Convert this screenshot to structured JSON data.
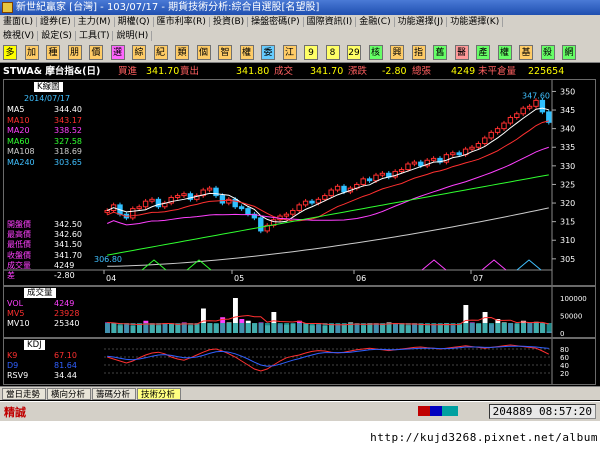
{
  "window": {
    "title": "新世紀贏家 [台灣] - 103/07/17 - 期貨技術分析:綜合自選股[名望股]"
  },
  "menu_row1": [
    "畫面(L)",
    "證券(E)",
    "主力(M)",
    "期權(Q)",
    "匯市利率(R)",
    "投資(B)",
    "操盤密碼(P)",
    "國際資訊(I)",
    "金融(C)",
    "功能選擇(J)",
    "功能選擇(K)"
  ],
  "menu_row2": [
    "檢視(V)",
    "設定(S)",
    "工具(T)",
    "說明(H)"
  ],
  "toolbar": {
    "buttons": [
      "多",
      "加",
      "種",
      "朋",
      "價",
      "選",
      "綜",
      "紀",
      "類",
      "個",
      "智",
      "權",
      "委",
      "江",
      "9",
      "8",
      "29",
      "核",
      "興",
      "指",
      "舊",
      "醫",
      "產",
      "權",
      "基",
      "殺",
      "網"
    ],
    "colors": [
      "#ffff00",
      "#ffcc66",
      "#ffcc66",
      "#ffcc66",
      "#ffcc66",
      "#ff66ff",
      "#ffcc66",
      "#ffcc66",
      "#ffcc66",
      "#ffcc66",
      "#ffcc66",
      "#ffcc66",
      "#66ccff",
      "#ffcc66",
      "#ffff66",
      "#ffff66",
      "#ffff66",
      "#66ff66",
      "#ffcc66",
      "#ffcc66",
      "#66ff66",
      "#ff9999",
      "#66ff66",
      "#66ff66",
      "#ffcc66",
      "#66ff66",
      "#66ff66"
    ]
  },
  "quote": {
    "symbol": "STWA& 摩台指&(日)",
    "bid_label": "買進",
    "bid": "341.70",
    "ask_label": "賣出",
    "ask": "341.80",
    "last_label": "成交",
    "last": "341.70",
    "change_label": "漲跌",
    "change": "-2.80",
    "volume_label": "總張",
    "volume": "4249",
    "oi_label": "未平倉量",
    "oi": "225654"
  },
  "kline_panel": {
    "title": "K線圖",
    "date": "2014/07/17",
    "ma": [
      {
        "label": "MA5",
        "value": "344.40",
        "color": "#ffffff"
      },
      {
        "label": "MA10",
        "value": "343.17",
        "color": "#ff3030"
      },
      {
        "label": "MA20",
        "value": "338.52",
        "color": "#ff40ff"
      },
      {
        "label": "MA60",
        "value": "327.58",
        "color": "#30ff30"
      },
      {
        "label": "MA108",
        "value": "318.69",
        "color": "#cccccc"
      },
      {
        "label": "MA240",
        "value": "303.65",
        "color": "#40c0ff"
      }
    ],
    "ohlc": [
      {
        "label": "開盤價",
        "value": "342.50"
      },
      {
        "label": "最高價",
        "value": "342.60"
      },
      {
        "label": "最低價",
        "value": "341.50"
      },
      {
        "label": "收盤價",
        "value": "341.70"
      },
      {
        "label": "成交量",
        "value": "4249"
      },
      {
        "label": "差",
        "value": "-2.80"
      }
    ],
    "high_marker": "347.60",
    "low_marker": "306.80",
    "y_ticks": [
      "350",
      "345",
      "340",
      "335",
      "330",
      "325",
      "320",
      "315",
      "310",
      "305"
    ],
    "x_ticks": [
      "04",
      "05",
      "06",
      "07"
    ]
  },
  "volume_panel": {
    "title": "成交量",
    "series": [
      {
        "label": "VOL",
        "value": "4249",
        "color": "#ff40ff"
      },
      {
        "label": "MV5",
        "value": "23928",
        "color": "#ff3030"
      },
      {
        "label": "MV10",
        "value": "25340",
        "color": "#ffffff"
      }
    ],
    "y_ticks": [
      "100000",
      "50000",
      "0"
    ]
  },
  "kd_panel": {
    "title": "KDJ",
    "series": [
      {
        "label": "K9",
        "value": "67.10",
        "color": "#ff3030"
      },
      {
        "label": "D9",
        "value": "81.64",
        "color": "#3060ff"
      },
      {
        "label": "RSV9",
        "value": "34.44",
        "color": "#ffffff"
      }
    ],
    "y_ticks": [
      "80",
      "60",
      "40",
      "20"
    ]
  },
  "tabs": [
    "當日走勢",
    "橫向分析",
    "籌碼分析",
    "技術分析"
  ],
  "status": {
    "left": "精誠",
    "right": "204889 08:57:20"
  },
  "footer": {
    "url": "http://kujd3268.pixnet.net/album"
  },
  "chart_data": [
    {
      "type": "candlestick",
      "title": "K線圖",
      "xlabel": "",
      "ylabel": "",
      "x_ticks": [
        "04",
        "05",
        "06",
        "07"
      ],
      "ylim": [
        302,
        352
      ],
      "closes": [
        318,
        319.5,
        317,
        316,
        318.5,
        319,
        320.5,
        321,
        319,
        320,
        321.5,
        322,
        322.5,
        321,
        322,
        323.5,
        324,
        322,
        320,
        321,
        319,
        318.5,
        317,
        316,
        312.5,
        314,
        315.5,
        316.5,
        317,
        318,
        319.5,
        320.5,
        320,
        321,
        322,
        323.5,
        324.5,
        323,
        324,
        325,
        326.5,
        326,
        327.5,
        328,
        327,
        328.5,
        329,
        330.5,
        331,
        330,
        331.5,
        332,
        331,
        333,
        333.5,
        333,
        334.5,
        335,
        336,
        337.5,
        339,
        340,
        341.5,
        343,
        344,
        345.5,
        346,
        347.6,
        344.5,
        341.7
      ],
      "ma_values": {
        "MA5": 344.4,
        "MA10": 343.17,
        "MA20": 338.52,
        "MA60": 327.58,
        "MA108": 318.69,
        "MA240": 303.65
      }
    },
    {
      "type": "bar",
      "title": "成交量",
      "ylim": [
        0,
        120000
      ],
      "values": [
        30000,
        28000,
        22000,
        25000,
        20000,
        26000,
        35000,
        24000,
        22000,
        28000,
        26000,
        24000,
        30000,
        22000,
        25000,
        70000,
        28000,
        26000,
        45000,
        30000,
        100000,
        40000,
        35000,
        28000,
        30000,
        22000,
        60000,
        25000,
        24000,
        26000,
        35000,
        28000,
        22000,
        24000,
        20000,
        26000,
        25000,
        23000,
        30000,
        24000,
        22000,
        28000,
        26000,
        24000,
        30000,
        27000,
        25000,
        22000,
        26000,
        24000,
        22000,
        23000,
        25000,
        28000,
        22000,
        24000,
        80000,
        30000,
        26000,
        60000,
        25000,
        40000,
        30000,
        28000,
        26000,
        35000,
        30000,
        32000,
        28000,
        4249
      ]
    },
    {
      "type": "line",
      "title": "KDJ",
      "ylim": [
        0,
        100
      ],
      "series": [
        {
          "name": "K9",
          "values": [
            60,
            55,
            50,
            45,
            50,
            58,
            65,
            70,
            72,
            68,
            60,
            55,
            52,
            58,
            65,
            72,
            78,
            80,
            75,
            68,
            60,
            50,
            40,
            30,
            25,
            30,
            40,
            50,
            58,
            62,
            65,
            70,
            74,
            76,
            75,
            72,
            70,
            72,
            75,
            78,
            80,
            82,
            80,
            78,
            76,
            78,
            80,
            82,
            84,
            85,
            83,
            82,
            80,
            82,
            84,
            86,
            88,
            86,
            84,
            82,
            84,
            86,
            88,
            90,
            88,
            86,
            84,
            82,
            75,
            67.1
          ]
        },
        {
          "name": "D9",
          "values": [
            62,
            60,
            57,
            54,
            53,
            55,
            58,
            62,
            65,
            66,
            64,
            61,
            58,
            58,
            60,
            64,
            69,
            73,
            74,
            72,
            68,
            62,
            55,
            47,
            40,
            37,
            38,
            42,
            47,
            52,
            56,
            61,
            65,
            69,
            71,
            71,
            71,
            71,
            72,
            74,
            76,
            78,
            79,
            79,
            78,
            78,
            79,
            80,
            81,
            82,
            82,
            82,
            81,
            81,
            82,
            83,
            85,
            85,
            85,
            84,
            84,
            85,
            86,
            87,
            87,
            87,
            86,
            85,
            83,
            81.64
          ]
        }
      ]
    }
  ]
}
